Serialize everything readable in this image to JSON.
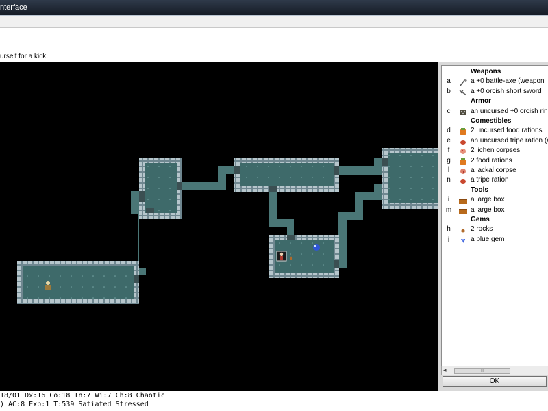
{
  "window": {
    "title": "nterface"
  },
  "message": "urself for a kick.",
  "status": {
    "line1": "18/01 Dx:16 Co:18 In:7 Wi:7 Ch:8  Chaotic",
    "line2": ") AC:8  Exp:1 T:539 Satiated Stressed"
  },
  "inventory": {
    "groups": [
      {
        "title": "Weapons",
        "items": [
          {
            "letter": "a",
            "icon": "battle-axe-icon",
            "text": "a +0 battle-axe (weapon in"
          },
          {
            "letter": "b",
            "icon": "short-sword-icon",
            "text": "a +0 orcish short sword"
          }
        ]
      },
      {
        "title": "Armor",
        "items": [
          {
            "letter": "c",
            "icon": "ring-mail-icon",
            "text": "an uncursed +0 orcish ring"
          }
        ]
      },
      {
        "title": "Comestibles",
        "items": [
          {
            "letter": "d",
            "icon": "food-ration-icon",
            "text": "2 uncursed food rations"
          },
          {
            "letter": "e",
            "icon": "tripe-ration-icon",
            "text": "an uncursed tripe ration (a"
          },
          {
            "letter": "f",
            "icon": "lichen-corpse-icon",
            "text": "2 lichen corpses"
          },
          {
            "letter": "g",
            "icon": "food-ration-icon",
            "text": "2 food rations"
          },
          {
            "letter": "l",
            "icon": "jackal-corpse-icon",
            "text": "a jackal corpse"
          },
          {
            "letter": "n",
            "icon": "tripe-ration-icon",
            "text": "a tripe ration"
          }
        ]
      },
      {
        "title": "Tools",
        "items": [
          {
            "letter": "i",
            "icon": "large-box-icon",
            "text": "a large box"
          },
          {
            "letter": "m",
            "icon": "large-box-icon",
            "text": "a large box"
          }
        ]
      },
      {
        "title": "Gems",
        "items": [
          {
            "letter": "h",
            "icon": "rock-icon",
            "text": "2 rocks"
          },
          {
            "letter": "j",
            "icon": "blue-gem-icon",
            "text": "a blue gem"
          }
        ]
      }
    ],
    "ok_label": "OK",
    "scroll_thumb": "|||"
  },
  "colors": {
    "floor": "#3e6a6a",
    "corridor": "#4a7676",
    "wall": "#8a9ea6"
  }
}
